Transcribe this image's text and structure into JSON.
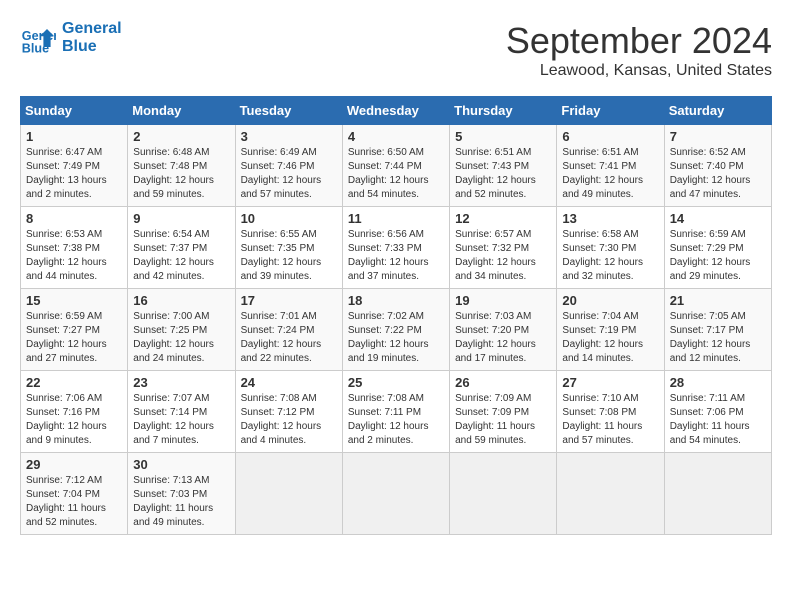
{
  "header": {
    "logo_line1": "General",
    "logo_line2": "Blue",
    "month_year": "September 2024",
    "location": "Leawood, Kansas, United States"
  },
  "weekdays": [
    "Sunday",
    "Monday",
    "Tuesday",
    "Wednesday",
    "Thursday",
    "Friday",
    "Saturday"
  ],
  "weeks": [
    [
      {
        "day": "1",
        "sunrise": "6:47 AM",
        "sunset": "7:49 PM",
        "daylight": "13 hours and 2 minutes."
      },
      {
        "day": "2",
        "sunrise": "6:48 AM",
        "sunset": "7:48 PM",
        "daylight": "12 hours and 59 minutes."
      },
      {
        "day": "3",
        "sunrise": "6:49 AM",
        "sunset": "7:46 PM",
        "daylight": "12 hours and 57 minutes."
      },
      {
        "day": "4",
        "sunrise": "6:50 AM",
        "sunset": "7:44 PM",
        "daylight": "12 hours and 54 minutes."
      },
      {
        "day": "5",
        "sunrise": "6:51 AM",
        "sunset": "7:43 PM",
        "daylight": "12 hours and 52 minutes."
      },
      {
        "day": "6",
        "sunrise": "6:51 AM",
        "sunset": "7:41 PM",
        "daylight": "12 hours and 49 minutes."
      },
      {
        "day": "7",
        "sunrise": "6:52 AM",
        "sunset": "7:40 PM",
        "daylight": "12 hours and 47 minutes."
      }
    ],
    [
      {
        "day": "8",
        "sunrise": "6:53 AM",
        "sunset": "7:38 PM",
        "daylight": "12 hours and 44 minutes."
      },
      {
        "day": "9",
        "sunrise": "6:54 AM",
        "sunset": "7:37 PM",
        "daylight": "12 hours and 42 minutes."
      },
      {
        "day": "10",
        "sunrise": "6:55 AM",
        "sunset": "7:35 PM",
        "daylight": "12 hours and 39 minutes."
      },
      {
        "day": "11",
        "sunrise": "6:56 AM",
        "sunset": "7:33 PM",
        "daylight": "12 hours and 37 minutes."
      },
      {
        "day": "12",
        "sunrise": "6:57 AM",
        "sunset": "7:32 PM",
        "daylight": "12 hours and 34 minutes."
      },
      {
        "day": "13",
        "sunrise": "6:58 AM",
        "sunset": "7:30 PM",
        "daylight": "12 hours and 32 minutes."
      },
      {
        "day": "14",
        "sunrise": "6:59 AM",
        "sunset": "7:29 PM",
        "daylight": "12 hours and 29 minutes."
      }
    ],
    [
      {
        "day": "15",
        "sunrise": "6:59 AM",
        "sunset": "7:27 PM",
        "daylight": "12 hours and 27 minutes."
      },
      {
        "day": "16",
        "sunrise": "7:00 AM",
        "sunset": "7:25 PM",
        "daylight": "12 hours and 24 minutes."
      },
      {
        "day": "17",
        "sunrise": "7:01 AM",
        "sunset": "7:24 PM",
        "daylight": "12 hours and 22 minutes."
      },
      {
        "day": "18",
        "sunrise": "7:02 AM",
        "sunset": "7:22 PM",
        "daylight": "12 hours and 19 minutes."
      },
      {
        "day": "19",
        "sunrise": "7:03 AM",
        "sunset": "7:20 PM",
        "daylight": "12 hours and 17 minutes."
      },
      {
        "day": "20",
        "sunrise": "7:04 AM",
        "sunset": "7:19 PM",
        "daylight": "12 hours and 14 minutes."
      },
      {
        "day": "21",
        "sunrise": "7:05 AM",
        "sunset": "7:17 PM",
        "daylight": "12 hours and 12 minutes."
      }
    ],
    [
      {
        "day": "22",
        "sunrise": "7:06 AM",
        "sunset": "7:16 PM",
        "daylight": "12 hours and 9 minutes."
      },
      {
        "day": "23",
        "sunrise": "7:07 AM",
        "sunset": "7:14 PM",
        "daylight": "12 hours and 7 minutes."
      },
      {
        "day": "24",
        "sunrise": "7:08 AM",
        "sunset": "7:12 PM",
        "daylight": "12 hours and 4 minutes."
      },
      {
        "day": "25",
        "sunrise": "7:08 AM",
        "sunset": "7:11 PM",
        "daylight": "12 hours and 2 minutes."
      },
      {
        "day": "26",
        "sunrise": "7:09 AM",
        "sunset": "7:09 PM",
        "daylight": "11 hours and 59 minutes."
      },
      {
        "day": "27",
        "sunrise": "7:10 AM",
        "sunset": "7:08 PM",
        "daylight": "11 hours and 57 minutes."
      },
      {
        "day": "28",
        "sunrise": "7:11 AM",
        "sunset": "7:06 PM",
        "daylight": "11 hours and 54 minutes."
      }
    ],
    [
      {
        "day": "29",
        "sunrise": "7:12 AM",
        "sunset": "7:04 PM",
        "daylight": "11 hours and 52 minutes."
      },
      {
        "day": "30",
        "sunrise": "7:13 AM",
        "sunset": "7:03 PM",
        "daylight": "11 hours and 49 minutes."
      },
      null,
      null,
      null,
      null,
      null
    ]
  ]
}
